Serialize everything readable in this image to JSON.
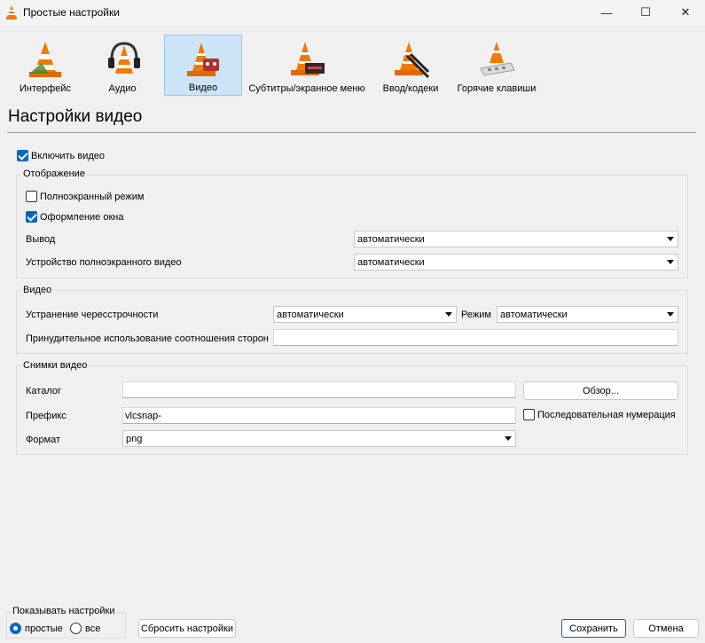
{
  "window": {
    "title": "Простые настройки",
    "minimize_glyph": "—",
    "maximize_glyph": "☐",
    "close_glyph": "✕"
  },
  "categories": [
    {
      "label": "Интерфейс",
      "icon": "cone-interface-icon",
      "selected": false
    },
    {
      "label": "Аудио",
      "icon": "cone-headphones-icon",
      "selected": false
    },
    {
      "label": "Видео",
      "icon": "cone-video-icon",
      "selected": true
    },
    {
      "label": "Субтитры/экранное меню",
      "icon": "cone-subtitles-icon",
      "selected": false
    },
    {
      "label": "Ввод/кодеки",
      "icon": "cone-codecs-icon",
      "selected": false
    },
    {
      "label": "Горячие клавиши",
      "icon": "cone-hotkeys-icon",
      "selected": false
    }
  ],
  "page_title": "Настройки видео",
  "enable_video": {
    "label": "Включить видео",
    "checked": true
  },
  "display": {
    "title": "Отображение",
    "fullscreen": {
      "label": "Полноэкранный режим",
      "checked": false
    },
    "decorations": {
      "label": "Оформление окна",
      "checked": true
    },
    "output_label": "Вывод",
    "output_value": "автоматически",
    "fs_device_label": "Устройство полноэкранного видео",
    "fs_device_value": "автоматически"
  },
  "video": {
    "title": "Видео",
    "deinterlace_label": "Устранение чересстрочности",
    "deinterlace_value": "автоматически",
    "mode_label": "Режим",
    "mode_value": "автоматически",
    "aspect_label": "Принудительное использование соотношения сторон",
    "aspect_value": ""
  },
  "snapshots": {
    "title": "Снимки видео",
    "directory_label": "Каталог",
    "directory_value": "",
    "browse_label": "Обзор...",
    "prefix_label": "Префикс",
    "prefix_value": "vlcsnap-",
    "sequential_label": "Последовательная нумерация",
    "sequential_checked": false,
    "format_label": "Формат",
    "format_value": "png"
  },
  "footer": {
    "show_settings_title": "Показывать настройки",
    "simple_label": "простые",
    "all_label": "все",
    "simple_selected": true,
    "reset_label": "Сбросить настройки",
    "save_label": "Сохранить",
    "cancel_label": "Отмена"
  },
  "colors": {
    "accent": "#0067c0",
    "selected_bg": "#cce4f7",
    "cone_orange": "#f07a00"
  }
}
